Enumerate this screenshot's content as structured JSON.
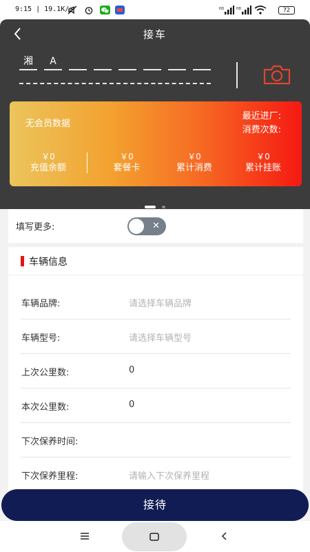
{
  "status_bar": {
    "time": "9:15",
    "speed": "19.1K/s",
    "battery": "72",
    "icons": [
      "mute-icon",
      "alarm-icon",
      "wechat-icon",
      "app-icon",
      "signal-icon",
      "wifi-icon",
      "battery-icon"
    ]
  },
  "header": {
    "title": "接车",
    "back_icon": "chevron-left-icon"
  },
  "plate": {
    "chars": [
      "湘",
      "A",
      "",
      "",
      "",
      "",
      "",
      ""
    ],
    "camera_icon": "camera-icon"
  },
  "member_card": {
    "no_member": "无会员数据",
    "last_visit_label": "最近进厂:",
    "visit_count_label": "消费次数:",
    "stats": [
      {
        "value": "￥0",
        "label": "充值余额"
      },
      {
        "value": "￥0",
        "label": "套餐卡"
      },
      {
        "value": "￥0",
        "label": "累计消费"
      },
      {
        "value": "￥0",
        "label": "累计挂账"
      }
    ],
    "carousel": {
      "pages": 2,
      "active": 0
    }
  },
  "more": {
    "label": "填写更多:",
    "toggle_on": false,
    "toggle_symbol": "✕"
  },
  "vehicle": {
    "title": "车辆信息",
    "accent_color": "#e51414",
    "fields": [
      {
        "label": "车辆品牌:",
        "value": "",
        "placeholder": "请选择车辆品牌"
      },
      {
        "label": "车辆型号:",
        "value": "",
        "placeholder": "请选择车辆型号"
      },
      {
        "label": "上次公里数:",
        "value": "0",
        "placeholder": ""
      },
      {
        "label": "本次公里数:",
        "value": "0",
        "placeholder": ""
      },
      {
        "label": "下次保养时间:",
        "value": "",
        "placeholder": ""
      },
      {
        "label": "下次保养里程:",
        "value": "",
        "placeholder": "请输入下次保养里程"
      }
    ]
  },
  "primary_button": {
    "label": "接待",
    "color": "#121c54"
  },
  "nav_bar": {
    "icons": [
      "menu-icon",
      "home-icon",
      "back-icon"
    ]
  }
}
